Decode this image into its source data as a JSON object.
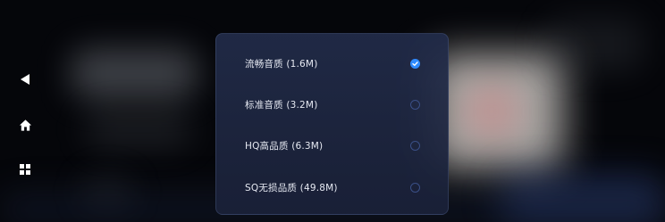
{
  "nav": {
    "back_icon": "back-arrow-icon",
    "home_icon": "home-icon",
    "apps_icon": "apps-grid-icon"
  },
  "quality_dialog": {
    "options": [
      {
        "label": "流畅音质 (1.6M)",
        "selected": true
      },
      {
        "label": "标准音质 (3.2M)",
        "selected": false
      },
      {
        "label": "HQ高品质 (6.3M)",
        "selected": false
      },
      {
        "label": "SQ无损品质 (49.8M)",
        "selected": false
      }
    ],
    "selected_color": "#2f8bff",
    "unselected_color": "#3a4f86"
  }
}
